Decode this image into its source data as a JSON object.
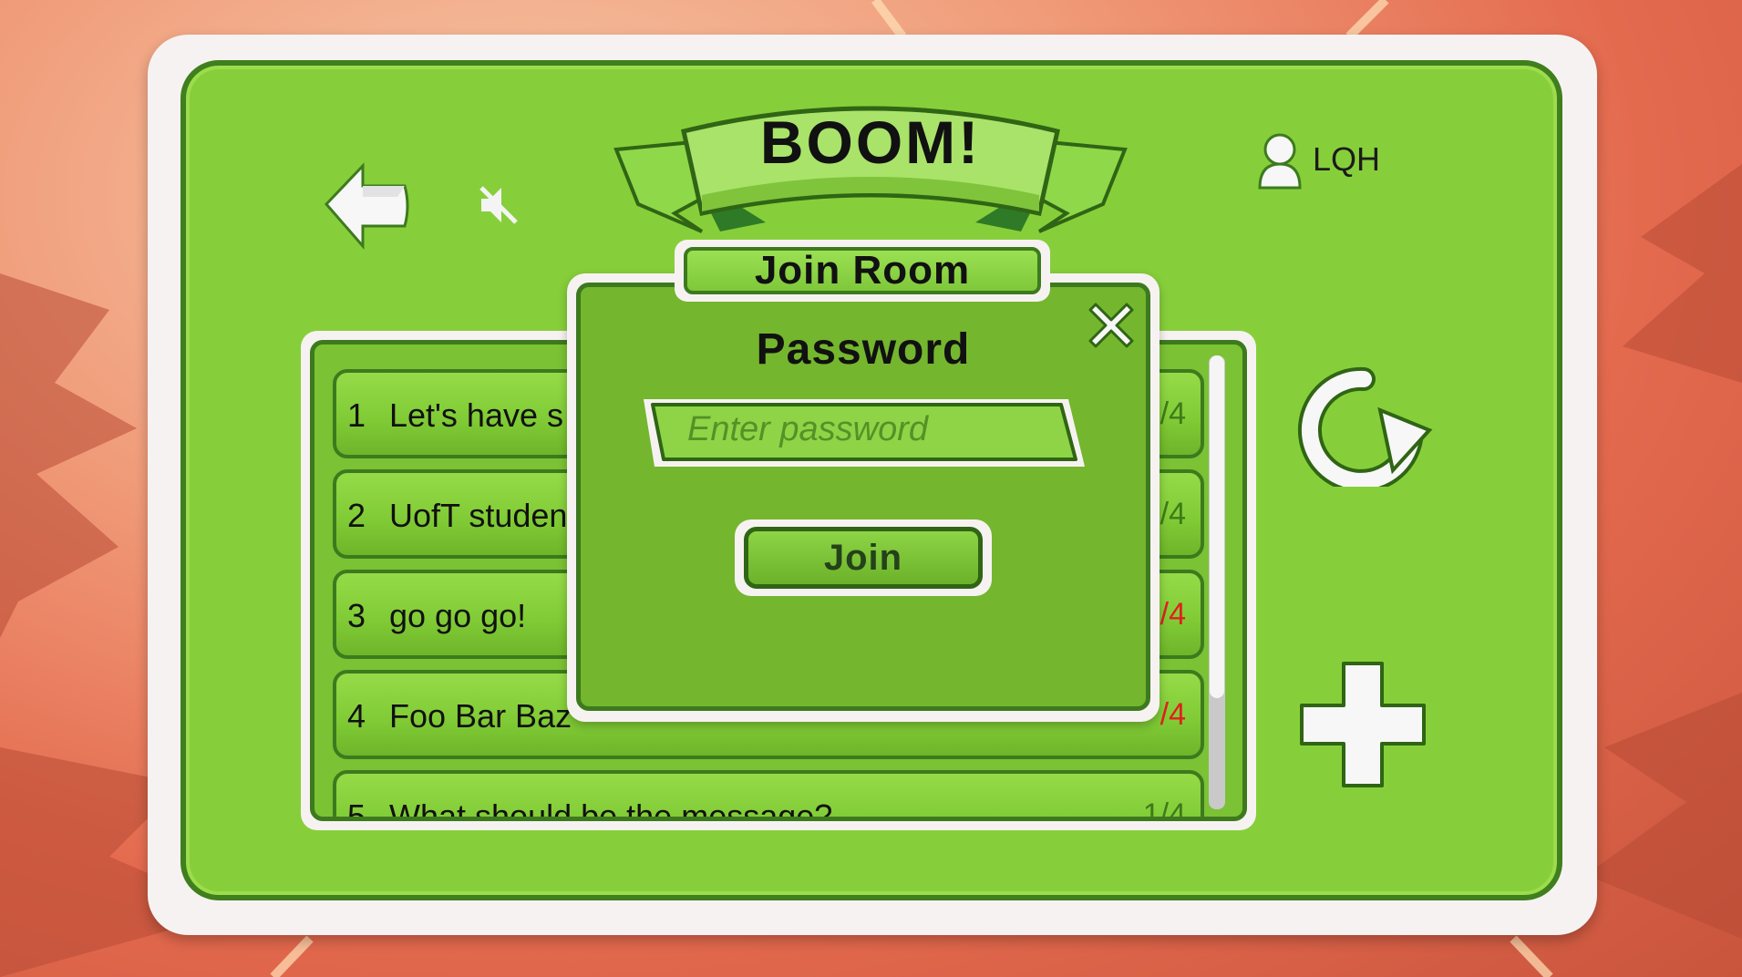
{
  "header": {
    "title": "BOOM!",
    "username": "LQH"
  },
  "icons": {
    "back": "back-arrow-icon",
    "mute": "speaker-muted-icon",
    "user": "user-icon",
    "refresh": "refresh-icon",
    "create": "plus-icon",
    "close": "close-icon"
  },
  "rooms": [
    {
      "num": "1",
      "name": "Let's have s",
      "count": "/4",
      "full": false
    },
    {
      "num": "2",
      "name": "UofT studen",
      "count": "/4",
      "full": false
    },
    {
      "num": "3",
      "name": "go go go!",
      "count": "/4",
      "full": true
    },
    {
      "num": "4",
      "name": "Foo Bar Baz",
      "count": "/4",
      "full": true
    },
    {
      "num": "5",
      "name": "What should be the message?",
      "count": "1/4",
      "full": false
    }
  ],
  "dialog": {
    "title": "Join Room",
    "label": "Password",
    "placeholder": "Enter password",
    "join_label": "Join"
  },
  "colors": {
    "panel": "#86cf3a",
    "outline": "#3d7a1e",
    "full_room": "#e02020"
  }
}
